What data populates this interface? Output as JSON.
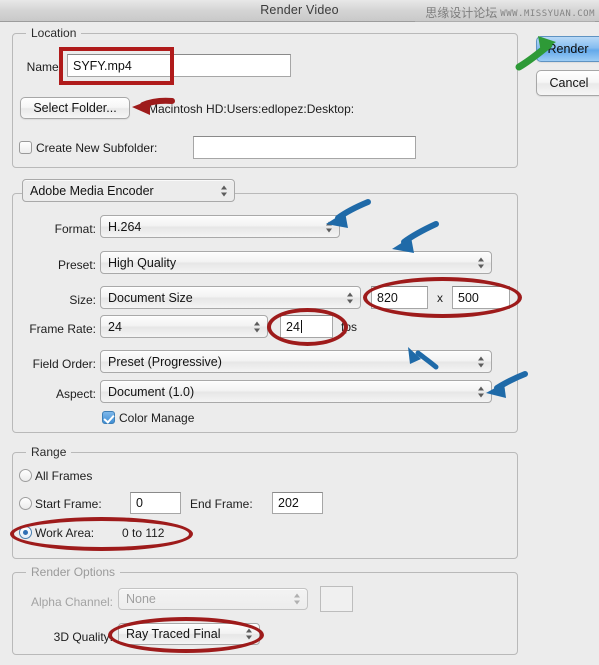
{
  "window": {
    "title": "Render Video"
  },
  "watermark": {
    "cn": "思缘设计论坛",
    "en": "WWW.MISSYUAN.COM"
  },
  "buttons": {
    "render": "Render",
    "cancel": "Cancel"
  },
  "location": {
    "group_title": "Location",
    "name_label": "Name:",
    "name_value": "SYFY.mp4",
    "select_folder_label": "Select Folder...",
    "path_text": "Macintosh HD:Users:edlopez:Desktop:",
    "create_subfolder_label": "Create New Subfolder:",
    "create_subfolder_checked": false,
    "subfolder_value": ""
  },
  "encoder": {
    "encoder_popup": "Adobe Media Encoder",
    "format_label": "Format:",
    "format_value": "H.264",
    "preset_label": "Preset:",
    "preset_value": "High Quality",
    "size_label": "Size:",
    "size_value": "Document Size",
    "size_width": "820",
    "size_x": "x",
    "size_height": "500",
    "frame_rate_label": "Frame Rate:",
    "frame_rate_value": "24",
    "frame_rate_custom": "24",
    "fps_label": "fps",
    "field_order_label": "Field Order:",
    "field_order_value": "Preset (Progressive)",
    "aspect_label": "Aspect:",
    "aspect_value": "Document (1.0)",
    "color_manage_label": "Color Manage",
    "color_manage_checked": true
  },
  "range": {
    "group_title": "Range",
    "all_frames_label": "All Frames",
    "start_frame_label": "Start Frame:",
    "start_frame_value": "0",
    "end_frame_label": "End Frame:",
    "end_frame_value": "202",
    "work_area_label": "Work Area:",
    "work_area_value": "0 to 112",
    "selected": "work_area"
  },
  "render_options": {
    "group_title": "Render Options",
    "alpha_channel_label": "Alpha Channel:",
    "alpha_channel_value": "None",
    "quality_label": "3D Quality:",
    "quality_value": "Ray Traced Final"
  },
  "colors": {
    "annotation_red": "#9e1b1b",
    "annotation_blue": "#1f6aa8",
    "annotation_green": "#2e9a37",
    "accent_blue": "#64a9ea"
  }
}
